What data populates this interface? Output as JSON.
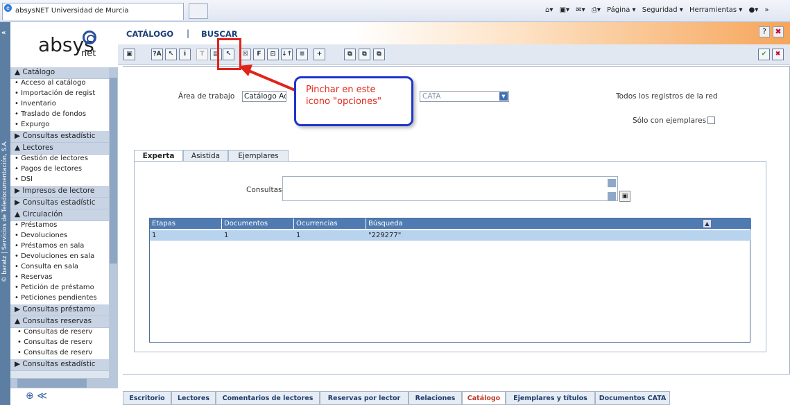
{
  "browser": {
    "tab_title": "absysNET Universidad de Murcia",
    "toolbar_items": [
      "Página ▾",
      "Seguridad ▾",
      "Herramientas ▾"
    ]
  },
  "sidebar": {
    "copyright": "© baratz | Servicios de Teledocumentación, S.A.",
    "logo_text": "absys",
    "logo_sub": "net",
    "sections": [
      {
        "title": "Catálogo",
        "items": [
          "Acceso al catálogo",
          "Importación de regist",
          "Inventario",
          "Traslado de fondos",
          "Expurgo"
        ],
        "subs": [
          "Consultas estadístic"
        ]
      },
      {
        "title": "Lectores",
        "items": [
          "Gestión de lectores",
          "Pagos de lectores",
          "DSI"
        ],
        "subs": [
          "Impresos de lectore",
          "Consultas estadístic"
        ]
      },
      {
        "title": "Circulación",
        "items": [
          "Préstamos",
          "Devoluciones",
          "Préstamos en sala",
          "Devoluciones en sala",
          "Consulta en sala",
          "Reservas",
          "Petición de préstamo",
          "Peticiones pendientes"
        ],
        "subs": [
          "Consultas préstamo",
          "Consultas reservas"
        ],
        "subitems": [
          "Consultas de reserv",
          "Consultas de reserv",
          "Consultas de reserv"
        ],
        "last_sub": "Consultas estadístic"
      }
    ]
  },
  "header": {
    "catalogo": "CATÁLOGO",
    "separator": "|",
    "buscar": "BUSCAR"
  },
  "toolbar_buttons": [
    "▣",
    "?A",
    "↖",
    "i",
    "T",
    "▤",
    "↖",
    "☒",
    "F",
    "⊡",
    "↓↑",
    "≡",
    "+",
    "⧉",
    "⧉",
    "⧉"
  ],
  "form": {
    "area_label": "Área de trabajo",
    "area_value": "Catálogo Ac",
    "db_value": "CATA",
    "all_records": "Todos los registros de la red",
    "only_copies": "Sólo con ejemplares",
    "consultas_label": "Consultas"
  },
  "tabs": [
    "Experta",
    "Asistida",
    "Ejemplares"
  ],
  "grid": {
    "headers": [
      "Etapas",
      "Documentos",
      "Ocurrencias",
      "Búsqueda"
    ],
    "rows": [
      [
        "1",
        "1",
        "1",
        "\"229277\""
      ]
    ]
  },
  "callout": {
    "line1": "Pinchar en este",
    "line2": "icono \"opciones\""
  },
  "bottom_tabs": [
    "Escritorio",
    "Lectores",
    "Comentarios de lectores",
    "Reservas por lector",
    "Relaciones",
    "Catálogo",
    "Ejemplares y títulos",
    "Documentos CATA"
  ],
  "colors": {
    "accent": "#1d3f7a",
    "callout_border": "#1d35c9",
    "callout_text": "#e3261b",
    "grid_header": "#4f7bb2",
    "grid_row": "#b8d3ee",
    "active_tab": "#c0392b"
  }
}
